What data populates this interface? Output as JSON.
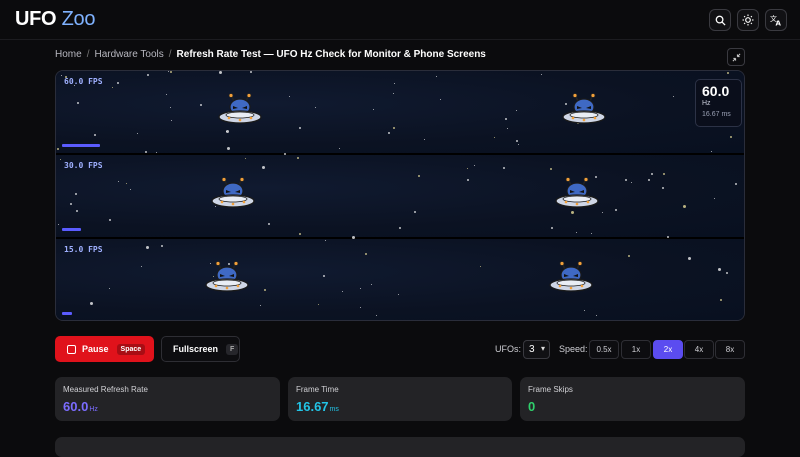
{
  "header": {
    "logo_part1": "UFO",
    "logo_part2": "Zoo",
    "icons": [
      "search-icon",
      "sun-icon",
      "translate-icon"
    ]
  },
  "breadcrumb": {
    "items": [
      "Home",
      "Hardware Tools"
    ],
    "current": "Refresh Rate Test — UFO Hz Check for Monitor & Phone Screens"
  },
  "stage": {
    "lanes": [
      {
        "label": "60.0 FPS",
        "fps": 60
      },
      {
        "label": "30.0 FPS",
        "fps": 30
      },
      {
        "label": "15.0 FPS",
        "fps": 15
      }
    ],
    "readout": {
      "value": "60.0",
      "unit": "Hz",
      "frame_ms": "16.67 ms"
    }
  },
  "controls": {
    "pause_label": "Pause",
    "pause_key": "Space",
    "fullscreen_label": "Fullscreen",
    "fullscreen_key": "F",
    "ufos_label": "UFOs:",
    "ufos_value": "3",
    "speed_label": "Speed:",
    "speeds": [
      "0.5x",
      "1x",
      "2x",
      "4x",
      "8x"
    ],
    "speed_selected": "2x"
  },
  "stats": [
    {
      "title": "Measured Refresh Rate",
      "value": "60.0",
      "unit": "Hz",
      "color": "#7b6cff"
    },
    {
      "title": "Frame Time",
      "value": "16.67",
      "unit": "ms",
      "color": "#22c3e6"
    },
    {
      "title": "Frame Skips",
      "value": "0",
      "unit": "",
      "color": "#2fcf6b"
    }
  ],
  "colors": {
    "accent": "#5b4cf0",
    "pause": "#e0121b",
    "lane_bar": "#5b5cff"
  }
}
